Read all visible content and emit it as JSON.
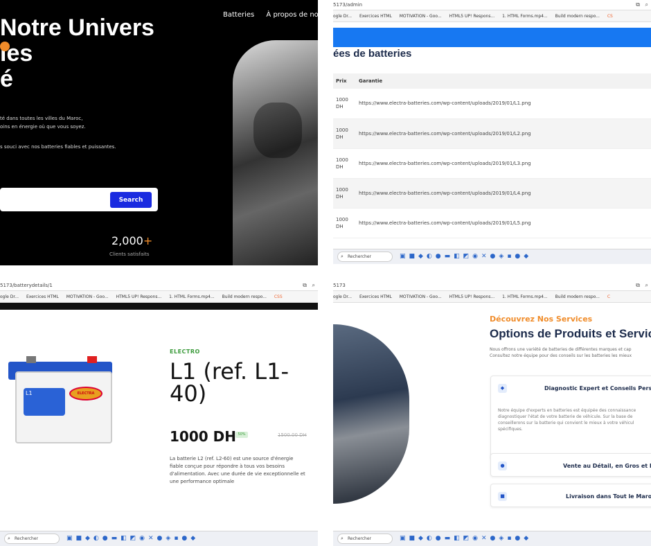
{
  "q1": {
    "nav": [
      "Batteries",
      "À propos de nou"
    ],
    "hero_lines": [
      "Notre Univers",
      "ies",
      "é"
    ],
    "sub_lines": [
      "té dans toutes les villes du Maroc,",
      "oins en énergie où que vous soyez.",
      "s souci avec nos batteries fiables et puissantes."
    ],
    "search_label": "Search",
    "stat_value": "2,000",
    "stat_plus": "+",
    "stat_label": "Clients satisfaits",
    "accent": "#f08c2a"
  },
  "q2": {
    "url": "5173/admin",
    "bookmarks": [
      "ogle Dr...",
      "Exercices HTML",
      "MOTIVATION - Goo...",
      "HTML5 UP! Respons...",
      "1. HTML Forms.mp4...",
      "Build modern respo...",
      "CS"
    ],
    "heading": "ées de batteries",
    "columns": [
      "Prix",
      "Garantie"
    ],
    "rows": [
      {
        "prix": "1000 DH",
        "garantie": "https://www.electra-batteries.com/wp-content/uploads/2019/01/L1.png"
      },
      {
        "prix": "1000 DH",
        "garantie": "https://www.electra-batteries.com/wp-content/uploads/2019/01/L2.png"
      },
      {
        "prix": "1000 DH",
        "garantie": "https://www.electra-batteries.com/wp-content/uploads/2019/01/L3.png"
      },
      {
        "prix": "1000 DH",
        "garantie": "https://www.electra-batteries.com/wp-content/uploads/2019/01/L4.png"
      },
      {
        "prix": "1000 DH",
        "garantie": "https://www.electra-batteries.com/wp-content/uploads/2019/01/L5.png"
      }
    ],
    "header_color": "#1778f2"
  },
  "q3": {
    "url": "5173/batterydetails/1",
    "bookmarks": [
      "ogle Dr...",
      "Exercices HTML",
      "MOTIVATION - Goo...",
      "HTML5 UP! Respons...",
      "1. HTML Forms.mp4...",
      "Build modern respo...",
      "CSS"
    ],
    "brand": "ELECTRO",
    "title": "L1 (ref. L1-40)",
    "price": "1000 DH",
    "discount": "50%",
    "old_price": "1500.00 DH",
    "description": "La batterie L2 (ref. L2-60) est une source d'énergie fiable conçue pour répondre à tous vos besoins d'alimentation. Avec une durée de vie exceptionnelle et une performance optimale",
    "battery_labels": {
      "model": "L1",
      "logo": "ELECTRA"
    }
  },
  "q4": {
    "url": "5173",
    "bookmarks": [
      "ogle Dr...",
      "Exercices HTML",
      "MOTIVATION - Goo...",
      "HTML5 UP! Respons...",
      "1. HTML Forms.mp4...",
      "Build modern respo...",
      "C"
    ],
    "kicker": "Découvrez Nos Services",
    "title": "Options de Produits et Service",
    "intro_lines": [
      "Nous offrons une variété de batteries de différentes marques et cap",
      "Consultez notre équipe pour des conseils sur les batteries les mieux"
    ],
    "cards": [
      {
        "title": "Diagnostic Expert et Conseils Person",
        "desc_lines": [
          "Notre équipe d'experts en batteries est équipée des connaissance",
          "diagnostiquer l'état de votre batterie de véhicule. Sur la base de",
          "conseillerons sur la batterie qui convient le mieux à votre véhicul",
          "spécifiques."
        ]
      },
      {
        "title": "Vente au Détail, en Gros et Plu",
        "desc_lines": []
      },
      {
        "title": "Livraison dans Tout le Maroc",
        "desc_lines": []
      }
    ]
  },
  "taskbar": {
    "search_placeholder": "Rechercher"
  }
}
